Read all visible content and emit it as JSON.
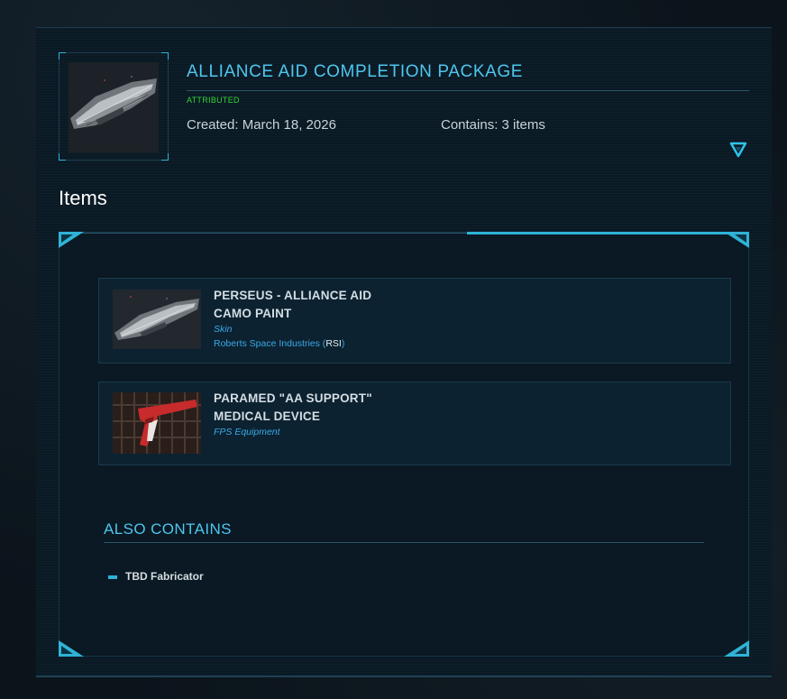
{
  "package": {
    "title": "ALLIANCE AID COMPLETION PACKAGE",
    "status": "ATTRIBUTED",
    "created": "Created: March 18, 2026",
    "contains": "Contains: 3 items",
    "expand_icon": "triangle-down-icon"
  },
  "items_section": {
    "title": "Items",
    "items": [
      {
        "name_line1": "PERSEUS - ALLIANCE AID",
        "name_line2": "CAMO PAINT",
        "type": "Skin",
        "manufacturer": "Roberts Space Industries (",
        "manufacturer_code": "RSI",
        "manufacturer_close": ")"
      },
      {
        "name_line1": "PARAMED \"AA SUPPORT\"",
        "name_line2": "MEDICAL DEVICE",
        "type": "FPS Equipment"
      }
    ]
  },
  "also_contains": {
    "title": "ALSO CONTAINS",
    "items": [
      "TBD Fabricator"
    ]
  },
  "colors": {
    "accent": "#4fc6ee",
    "status_green": "#34d334",
    "link_blue": "#3aa9e8",
    "panel_bg": "#0a1a25"
  }
}
